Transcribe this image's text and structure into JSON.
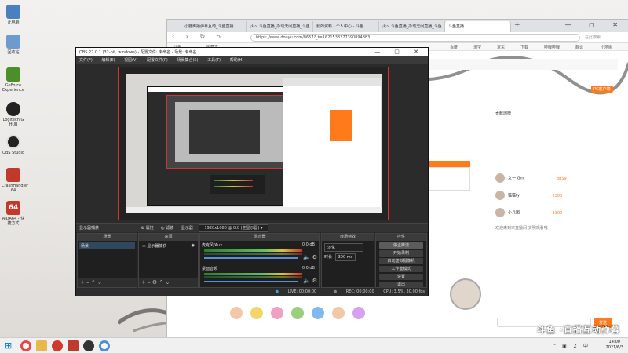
{
  "desktop": {
    "icons": [
      {
        "label": "此电脑",
        "color": "#4a7fc0"
      },
      {
        "label": "回收站",
        "color": "#6c9bd0"
      },
      {
        "label": "GeForce Experience",
        "color": "#4a8f2a"
      },
      {
        "label": "Logitech G HUB",
        "color": "#222222"
      },
      {
        "label": "OBS Studio",
        "color": "#222222"
      },
      {
        "label": "CrashHandler 64",
        "color": "#c0392b"
      },
      {
        "label": "AIDA64 - 快捷方式",
        "color": "#c0392b"
      }
    ]
  },
  "browser": {
    "tabs": [
      {
        "label": "小鹿声播弹幕互动_斗鱼直播"
      },
      {
        "label": "火~ 斗鱼直播_办动无间直播_斗鱼"
      },
      {
        "label": "我的资料 - 个人中心 - 斗鱼"
      },
      {
        "label": "火~ 斗鱼直播_办动无间直播_斗鱼"
      },
      {
        "label": "斗鱼直播"
      }
    ],
    "url": "https://www.douyu.com/8657?_t=1621533277390894883",
    "search_placeholder": "在此搜索",
    "bookmarks": [
      "斗鱼",
      "收藏夹",
      "百度",
      "淘宝",
      "京东",
      "下载",
      "哔哩哔哩",
      "翻译",
      "小地图"
    ],
    "page": {
      "orange_badge": "PC客户端",
      "sub_label": "关注",
      "rank_title": "贡献周榜",
      "rank": [
        {
          "name": "女一 Gm",
          "score": "8859"
        },
        {
          "name": "猫猫ty",
          "score": "2300"
        },
        {
          "name": "小兵团",
          "score": "1300"
        }
      ],
      "notice": "欢迎来到本直播间 文明观看哦",
      "send": "发送"
    }
  },
  "obs": {
    "title": "OBS 27.0.1 (32-bit, windows) - 配置文件: 未命名 - 场景: 未命名",
    "menu": [
      "文件(F)",
      "编辑(E)",
      "视图(V)",
      "配置文件(P)",
      "场景集合(S)",
      "工具(T)",
      "帮助(H)"
    ],
    "scenebar": {
      "source_label": "显示器捕获",
      "properties": "属性",
      "filters": "滤镜",
      "display_label": "显示器",
      "display_value": "1920x1080 @ 0,0 (主显示器)"
    },
    "docks": {
      "scenes": {
        "title": "场景",
        "items": [
          "场景"
        ]
      },
      "sources": {
        "title": "来源",
        "items": [
          "显示器捕获"
        ]
      },
      "mixer": {
        "title": "混音器",
        "tracks": [
          {
            "name": "麦克风/Aux",
            "db": "0.0 dB"
          },
          {
            "name": "桌面音频",
            "db": "0.0 dB"
          }
        ]
      },
      "transitions": {
        "title": "转场特效",
        "type": "淡化",
        "duration_label": "时长",
        "duration": "300 ms"
      },
      "controls": {
        "title": "控件",
        "buttons": [
          "停止推流",
          "开始录制",
          "启动虚拟摄像机",
          "工作室模式",
          "设置",
          "退出"
        ]
      }
    },
    "status": {
      "live": "LIVE: 00:00:00",
      "rec": "REC: 00:00:00",
      "cpu": "CPU: 3.5%, 30.00 fps"
    }
  },
  "taskbar": {
    "time": "14:00",
    "date": "2021/6/3",
    "lang": "中",
    "apps": [
      "#ffffff",
      "#e8b84a",
      "#d03a2c",
      "#c0392b",
      "#333333",
      "#1f1f1f",
      "#4a8fe0"
    ]
  },
  "watermark": "斗鱼 ·直播互动弹幕"
}
